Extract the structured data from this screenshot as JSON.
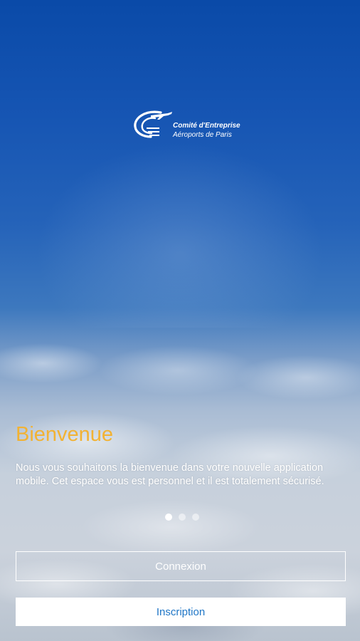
{
  "logo": {
    "line1": "Comité d'Entreprise",
    "line2": "Aéroports de Paris"
  },
  "welcome": {
    "title": "Bienvenue",
    "text": "Nous vous souhaitons la bienvenue dans votre nouvelle application mobile. Cet espace vous est personnel et il est totalement sécurisé."
  },
  "pager": {
    "total": 3,
    "active_index": 0
  },
  "buttons": {
    "connexion": "Connexion",
    "inscription": "Inscription"
  },
  "colors": {
    "title_accent": "#f2b233",
    "inscription_text": "#1f76c6"
  }
}
